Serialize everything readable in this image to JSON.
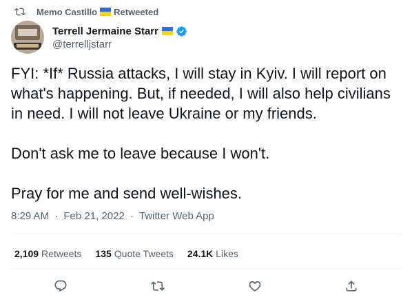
{
  "retweet": {
    "user": "Memo Castillo",
    "label": "Retweeted",
    "icon": "retweet-icon",
    "flag_colors": [
      "#2f6fd8",
      "#f7d21d"
    ]
  },
  "author": {
    "display_name": "Terrell Jermaine Starr",
    "handle": "@terrelljstarr",
    "verified": true,
    "verified_color": "#1d9bf0"
  },
  "tweet": {
    "paragraphs": [
      "FYI: *If* Russia attacks, I will stay in Kyiv. I will report on what's happening. But, if needed, I will also help civilians in need. I will not leave Ukraine or my friends.",
      "Don't ask me to leave because I won't.",
      "Pray for me and send well-wishes."
    ],
    "time": "8:29 AM",
    "date": "Feb 21, 2022",
    "source": "Twitter Web App",
    "separator": "·"
  },
  "stats": {
    "retweets_count": "2,109",
    "retweets_label": "Retweets",
    "quotes_count": "135",
    "quotes_label": "Quote Tweets",
    "likes_count": "24.1K",
    "likes_label": "Likes"
  },
  "actions": [
    {
      "name": "reply-icon"
    },
    {
      "name": "retweet-icon"
    },
    {
      "name": "like-icon"
    },
    {
      "name": "share-icon"
    }
  ],
  "colors": {
    "text": "#0f1419",
    "secondary": "#536471",
    "divider": "#eff3f4"
  }
}
